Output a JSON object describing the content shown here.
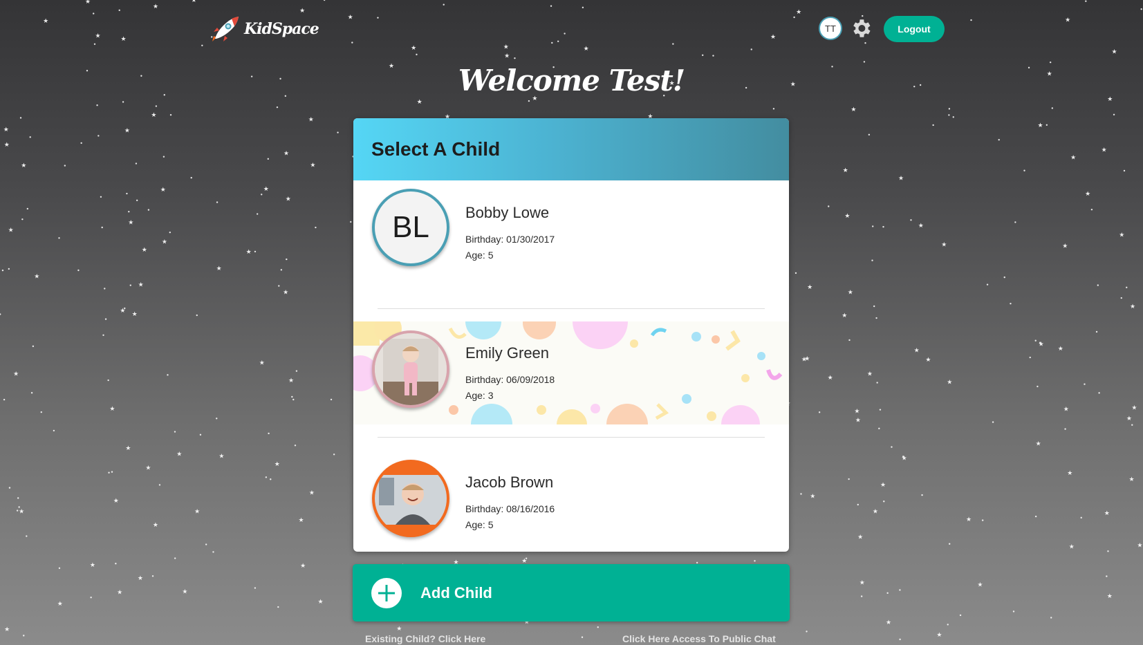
{
  "header": {
    "brand": "KidSpace",
    "user_initials": "TT",
    "logout_label": "Logout"
  },
  "welcome": "Welcome Test!",
  "card": {
    "title": "Select A Child",
    "children": [
      {
        "initials": "BL",
        "name": "Bobby Lowe",
        "birthday": "Birthday: 01/30/2017",
        "age": "Age: 5",
        "ring_color": "#4a9fb4"
      },
      {
        "name": "Emily Green",
        "birthday": "Birthday: 06/09/2018",
        "age": "Age: 3",
        "ring_color": "#d8a3ac"
      },
      {
        "name": "Jacob Brown",
        "birthday": "Birthday: 08/16/2016",
        "age": "Age: 5",
        "ring_color": "#f26a1f"
      }
    ]
  },
  "add_child_label": "Add Child",
  "footer": {
    "existing_child": "Existing Child? Click Here",
    "public_chat": "Click Here Access To Public Chat"
  },
  "colors": {
    "accent": "#00b194",
    "header_start": "#55d6f5",
    "header_end": "#438da0"
  }
}
